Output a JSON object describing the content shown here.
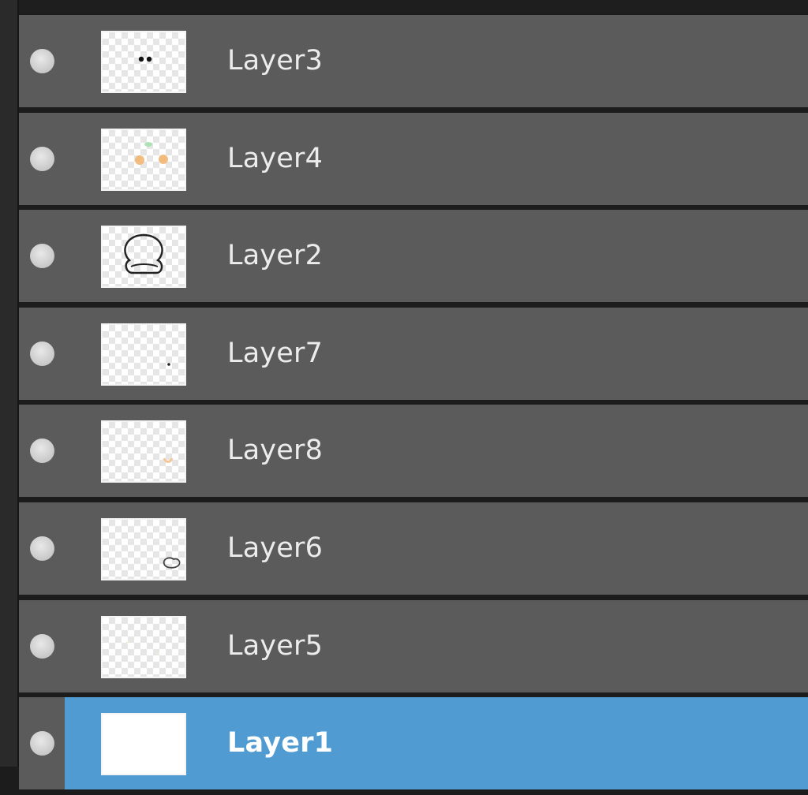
{
  "layers_panel": {
    "layers": [
      {
        "name": "Layer3",
        "thumbnail": "eyes",
        "visible": true,
        "selected": false
      },
      {
        "name": "Layer4",
        "thumbnail": "cheeks",
        "visible": true,
        "selected": false
      },
      {
        "name": "Layer2",
        "thumbnail": "head-outline",
        "visible": true,
        "selected": false
      },
      {
        "name": "Layer7",
        "thumbnail": "small-dot",
        "visible": true,
        "selected": false
      },
      {
        "name": "Layer8",
        "thumbnail": "small-orange-mark",
        "visible": true,
        "selected": false
      },
      {
        "name": "Layer6",
        "thumbnail": "small-shape",
        "visible": true,
        "selected": false
      },
      {
        "name": "Layer5",
        "thumbnail": "faint-marks",
        "visible": true,
        "selected": false
      },
      {
        "name": "Layer1",
        "thumbnail": "white-fill",
        "visible": true,
        "selected": true
      }
    ]
  },
  "colors": {
    "row_background": "#5b5b5b",
    "selected_background": "#4f9bd2",
    "panel_background": "#1c1c1c",
    "text": "#ececec"
  }
}
